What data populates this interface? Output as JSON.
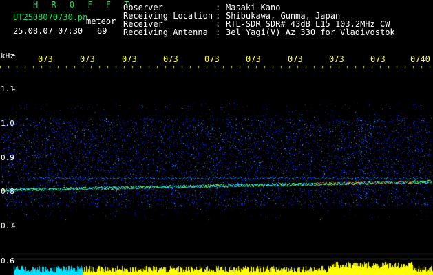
{
  "header": {
    "brand": "H R O F F T",
    "filename": "UT2508070730.pn",
    "tag": "meteor",
    "datetime": "25.08.07 07:30",
    "count": "69"
  },
  "info": [
    {
      "label": "Observer",
      "value": "Masaki Kano"
    },
    {
      "label": "Receiving Location",
      "value": "Shibukawa, Gunma, Japan"
    },
    {
      "label": "Receiver",
      "value": "RTL-SDR SDR# 43dB L15 103.2MHz CW"
    },
    {
      "label": "Receiving Antenna",
      "value": "3el Yagi(V) Az 330 for Vladivostok"
    }
  ],
  "info_separator": ":",
  "axis": {
    "unit": "kHz",
    "y_ticks": [
      "1.1",
      "1.0",
      "0.9",
      "0.8",
      "0.7",
      "0.6"
    ],
    "x_ticks": [
      "073",
      "073",
      "073",
      "073",
      "073",
      "073",
      "073",
      "073",
      "073",
      "0740"
    ]
  },
  "colors": {
    "background": "#000000",
    "brand_green": "#2fd65a",
    "tick_yellow": "#ffff40",
    "signal_cold": "#0a1fd0",
    "signal_mid": "#2fd65a",
    "signal_hot": "#ff2a10",
    "meter_yellow": "#ffff00",
    "meter_cyan": "#00e0ff"
  }
}
